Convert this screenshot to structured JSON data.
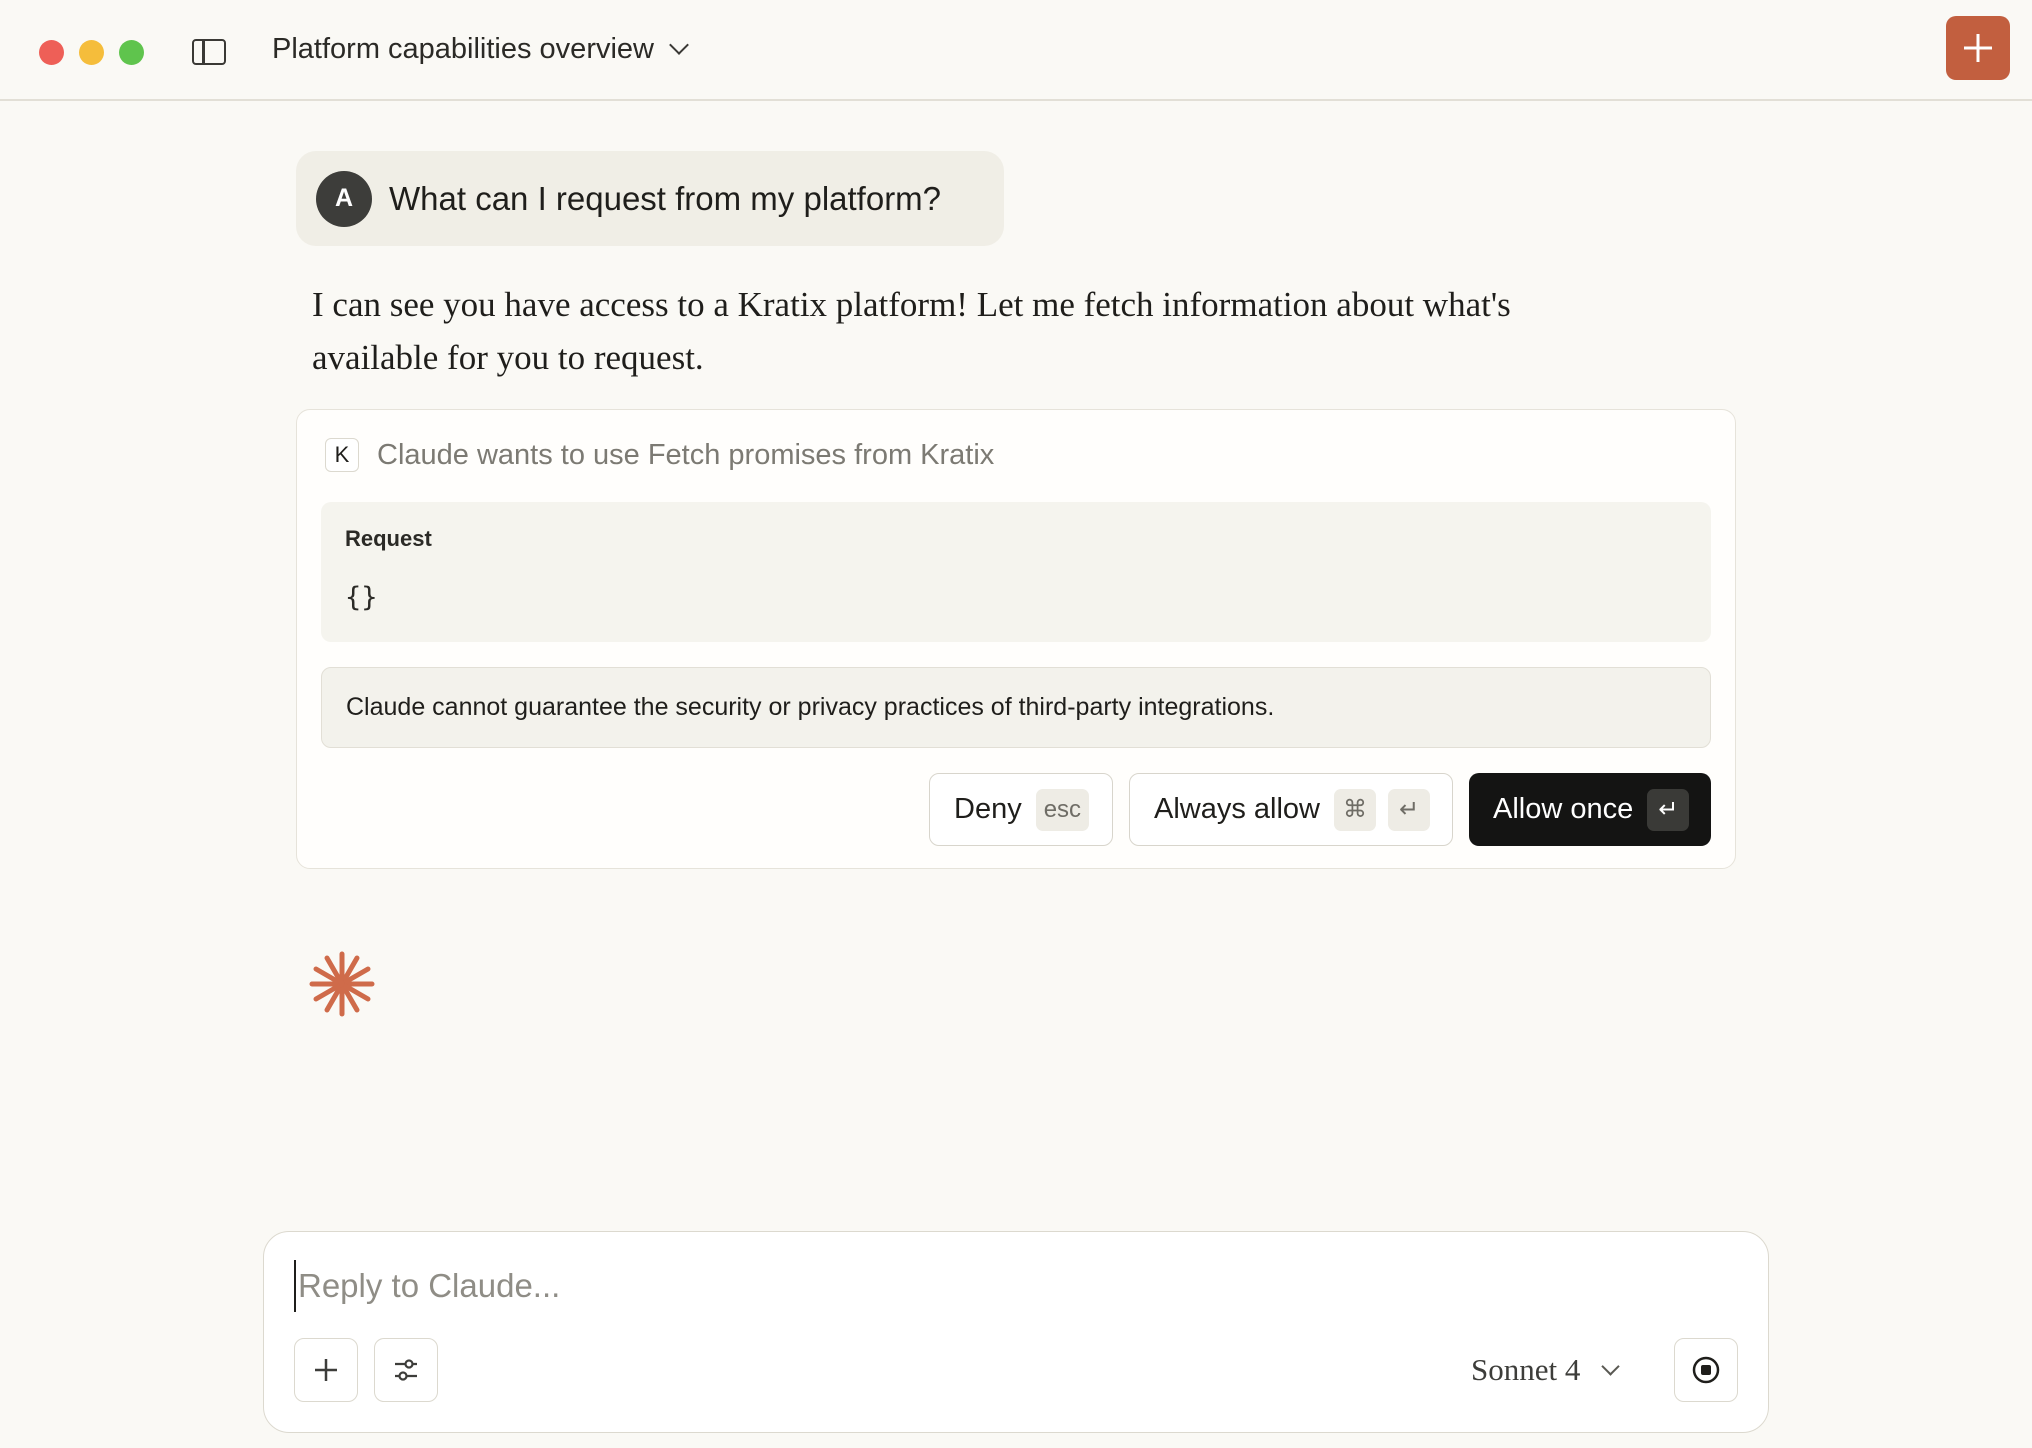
{
  "window": {
    "conversation_title": "Platform capabilities overview"
  },
  "colors": {
    "accent": "#c25f3f",
    "background": "#faf9f5",
    "allow_button": "#141413"
  },
  "icons": [
    "sidebar-toggle-icon",
    "chevron-down-icon",
    "plus-icon",
    "return-key-icon",
    "command-key-icon",
    "sliders-icon",
    "stop-icon",
    "claude-spark-icon"
  ],
  "user_message": {
    "avatar_initial": "A",
    "text": "What can I request from my platform?"
  },
  "assistant_message": {
    "text": "I can see you have access to a Kratix platform! Let me fetch information about what's available for you to request."
  },
  "permission_card": {
    "integration_initial": "K",
    "title": "Claude wants to use Fetch promises from Kratix",
    "request_label": "Request",
    "request_body": "{}",
    "warning": "Claude cannot guarantee the security or privacy practices of third-party integrations.",
    "deny_label": "Deny",
    "deny_shortcut": "esc",
    "always_allow_label": "Always allow",
    "always_allow_shortcut_1": "⌘",
    "always_allow_shortcut_2": "↵",
    "allow_once_label": "Allow once",
    "allow_once_shortcut": "↵"
  },
  "composer": {
    "placeholder": "Reply to Claude...",
    "value": "",
    "model": "Sonnet 4"
  }
}
